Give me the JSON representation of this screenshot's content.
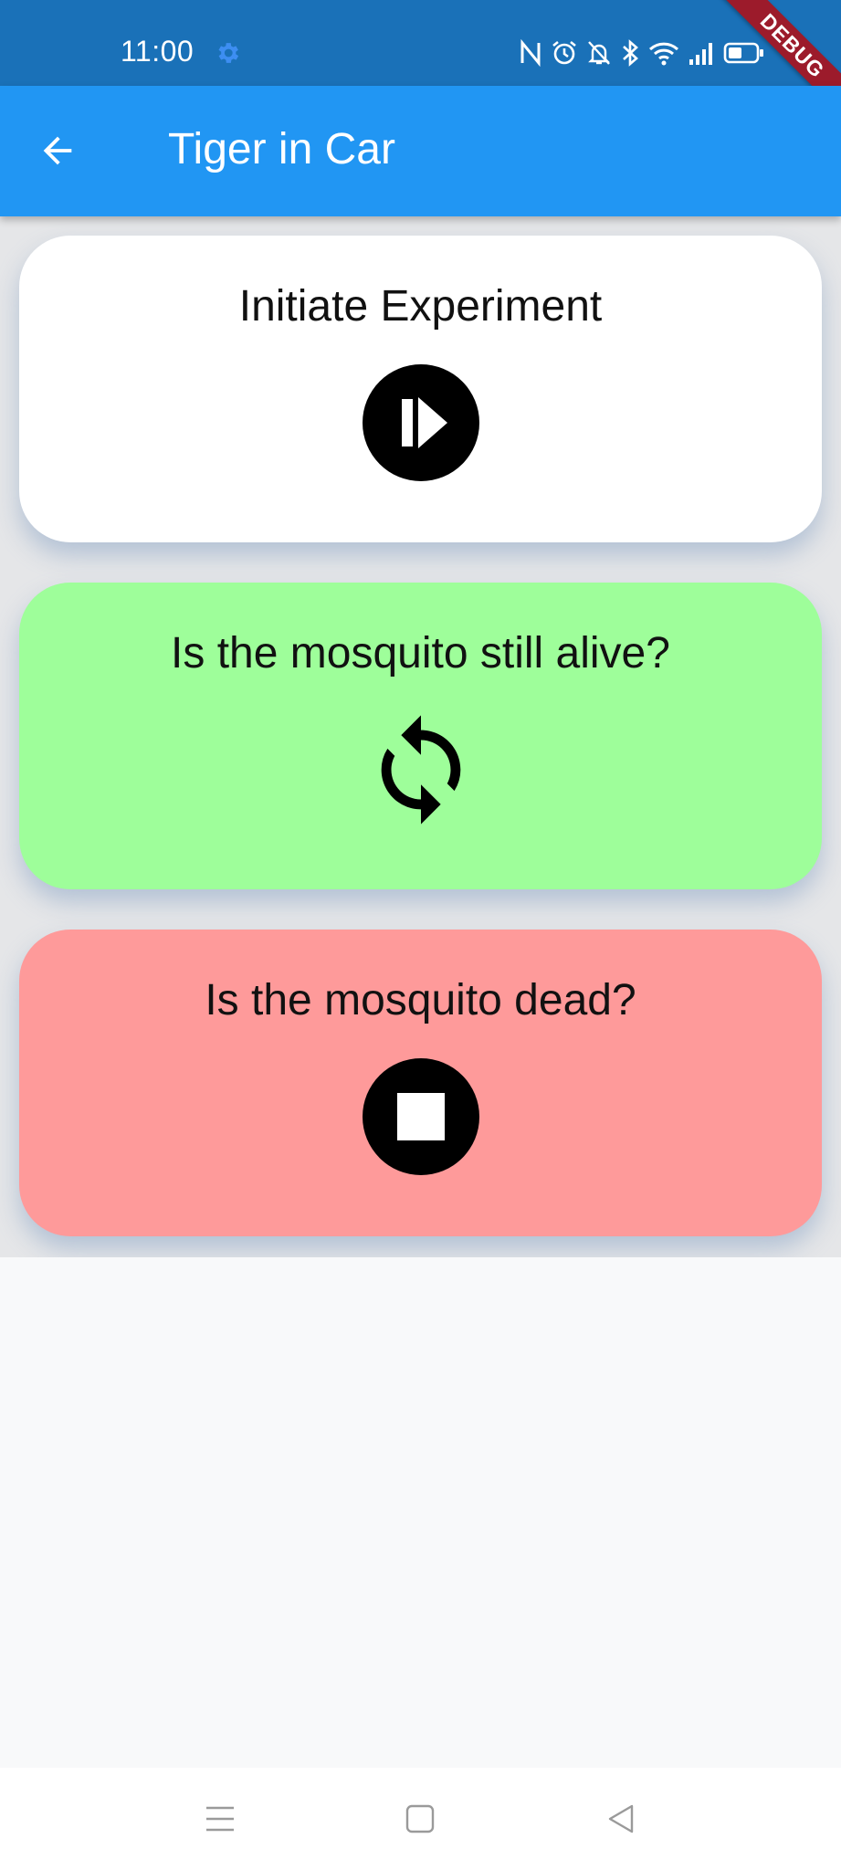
{
  "status_bar": {
    "time": "11:00",
    "debug_label": "DEBUG",
    "icons": [
      "settings-gear-icon",
      "nfc-icon",
      "alarm-icon",
      "mute-notifications-icon",
      "bluetooth-icon",
      "wifi-icon",
      "signal-icon",
      "battery-icon"
    ]
  },
  "app_bar": {
    "title": "Tiger in Car",
    "back_icon": "arrow-back-icon",
    "background": "#2196f3"
  },
  "cards": [
    {
      "title": "Initiate Experiment",
      "icon": "play-circle-icon",
      "background": "#ffffff"
    },
    {
      "title": "Is the mosquito still alive?",
      "icon": "sync-icon",
      "background": "#9efe9a"
    },
    {
      "title": "Is the mosquito dead?",
      "icon": "stop-circle-icon",
      "background": "#fe9a9a"
    }
  ],
  "nav_bar": {
    "buttons": [
      "menu-icon",
      "home-square-icon",
      "back-triangle-icon"
    ]
  }
}
